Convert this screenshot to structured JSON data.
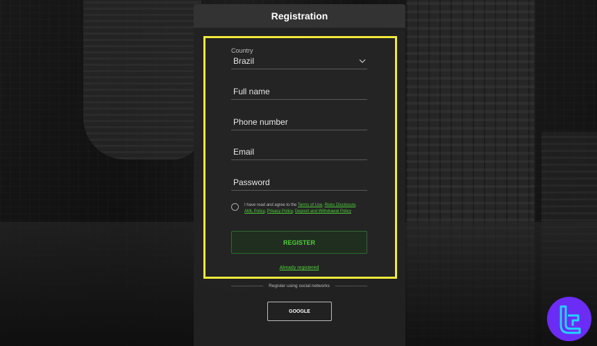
{
  "header": {
    "title": "Registration"
  },
  "form": {
    "country_label": "Country",
    "country_value": "Brazil",
    "full_name": "Full name",
    "phone": "Phone number",
    "email": "Email",
    "password": "Password"
  },
  "terms": {
    "prefix": "I have read and agree to the ",
    "terms_of_use": "Terms of Use",
    "risks": "Risks Disclosure",
    "aml": "AML Policy",
    "privacy": "Privacy Policy",
    "deposit": "Deposit and Withdrawal Policy"
  },
  "actions": {
    "register": "REGISTER",
    "already": "Already registered"
  },
  "social": {
    "label": "Register using social networks",
    "google": "GOOGLE"
  },
  "colors": {
    "accent_green": "#4cd137",
    "highlight_yellow": "#f3ea3b",
    "logo_purple": "#6b2cf5"
  }
}
